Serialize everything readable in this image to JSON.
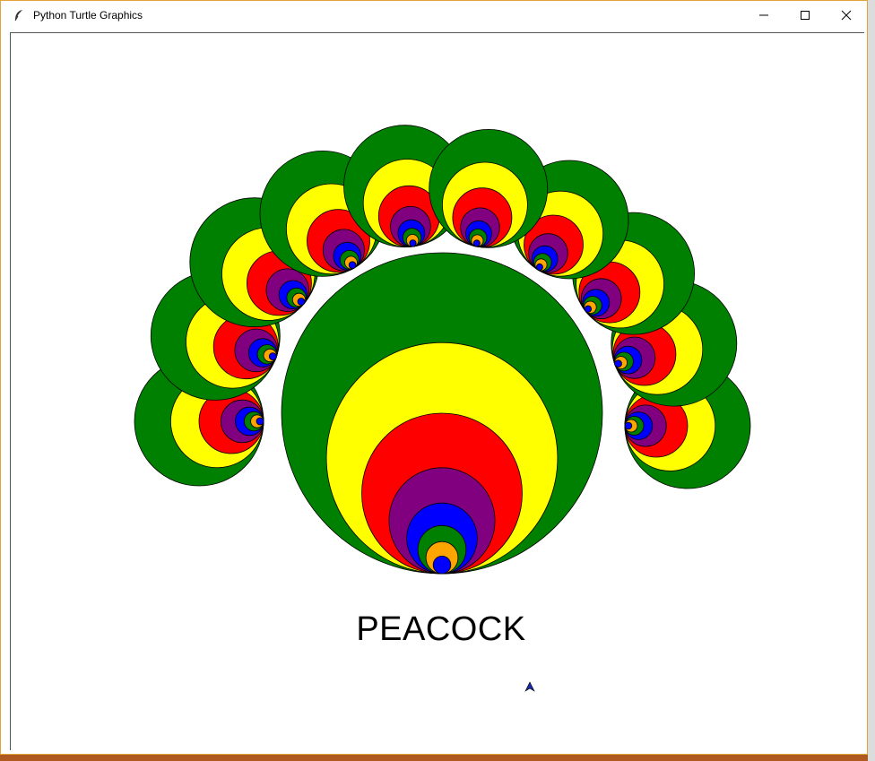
{
  "window": {
    "title": "Python Turtle Graphics",
    "controls": {
      "minimize": "minimize",
      "maximize": "maximize",
      "close": "close"
    }
  },
  "canvas": {
    "label": "PEACOCK",
    "colors": {
      "green": "#008000",
      "yellow": "#ffff00",
      "red": "#ff0000",
      "purple": "#800080",
      "blue": "#0000ff",
      "orange": "#ffa500",
      "outline": "#000000"
    },
    "ring_order": [
      "green",
      "yellow",
      "red",
      "purple",
      "blue",
      "green",
      "orange",
      "blue"
    ]
  },
  "icons": {
    "app": "feather-icon",
    "cursor": "turtle-arrow-icon"
  }
}
